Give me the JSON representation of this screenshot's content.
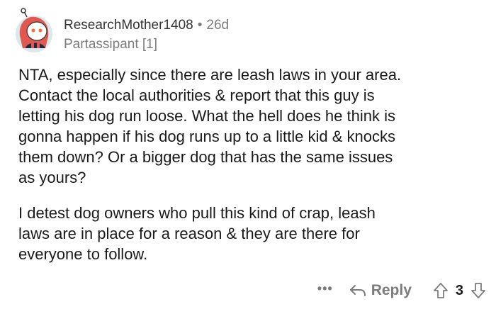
{
  "comment": {
    "username": "ResearchMother1408",
    "separator": "•",
    "age": "26d",
    "flair": "Partassipant [1]",
    "paragraphs": [
      "NTA, especially since there are leash laws in your area.\nContact the local authorities & report that this guy is\nletting his dog run loose.  What the hell does he think is\ngonna happen if his dog runs up to a little kid & knocks\nthem down?  Or a bigger dog that has the same issues\nas yours?",
      "I detest dog owners who pull this kind of crap, leash\nlaws are in place for a reason & they are there for\neveryone to follow."
    ]
  },
  "actions": {
    "more_label": "•••",
    "reply_label": "Reply",
    "vote_count": "3"
  },
  "colors": {
    "text": "#1a1a1b",
    "muted": "#7c7c7c",
    "avatar_bg": "#dbe8ec",
    "avatar_hair": "#e0584f"
  },
  "icons": [
    "avatar-icon",
    "reply-arrow-icon",
    "upvote-arrow-icon",
    "downvote-arrow-icon",
    "more-options-icon"
  ]
}
